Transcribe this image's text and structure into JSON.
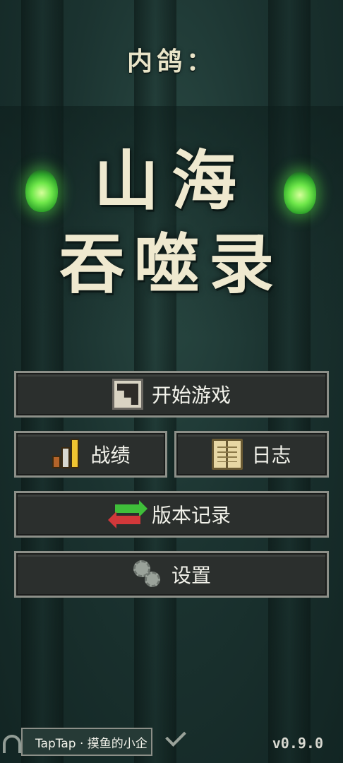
{
  "title": {
    "subtitle": "内鸽：",
    "line1": "山海",
    "line2": "吞噬录"
  },
  "menu": {
    "start_game": "开始游戏",
    "stats": "战绩",
    "log": "日志",
    "version_history": "版本记录",
    "settings": "设置"
  },
  "icons": {
    "start_game": "stairs-icon",
    "stats": "bar-chart-icon",
    "log": "book-icon",
    "version_history": "refresh-arrows-icon",
    "settings": "gears-icon"
  },
  "footer": {
    "tag": "TapTap · 摸鱼的小企",
    "version": "v0.9.0"
  },
  "colors": {
    "background": "#1b3330",
    "button_bg": "#2b2f2d",
    "button_border": "#8c8f88",
    "title_text": "#efe9cf",
    "flame": "#6fe84a"
  }
}
